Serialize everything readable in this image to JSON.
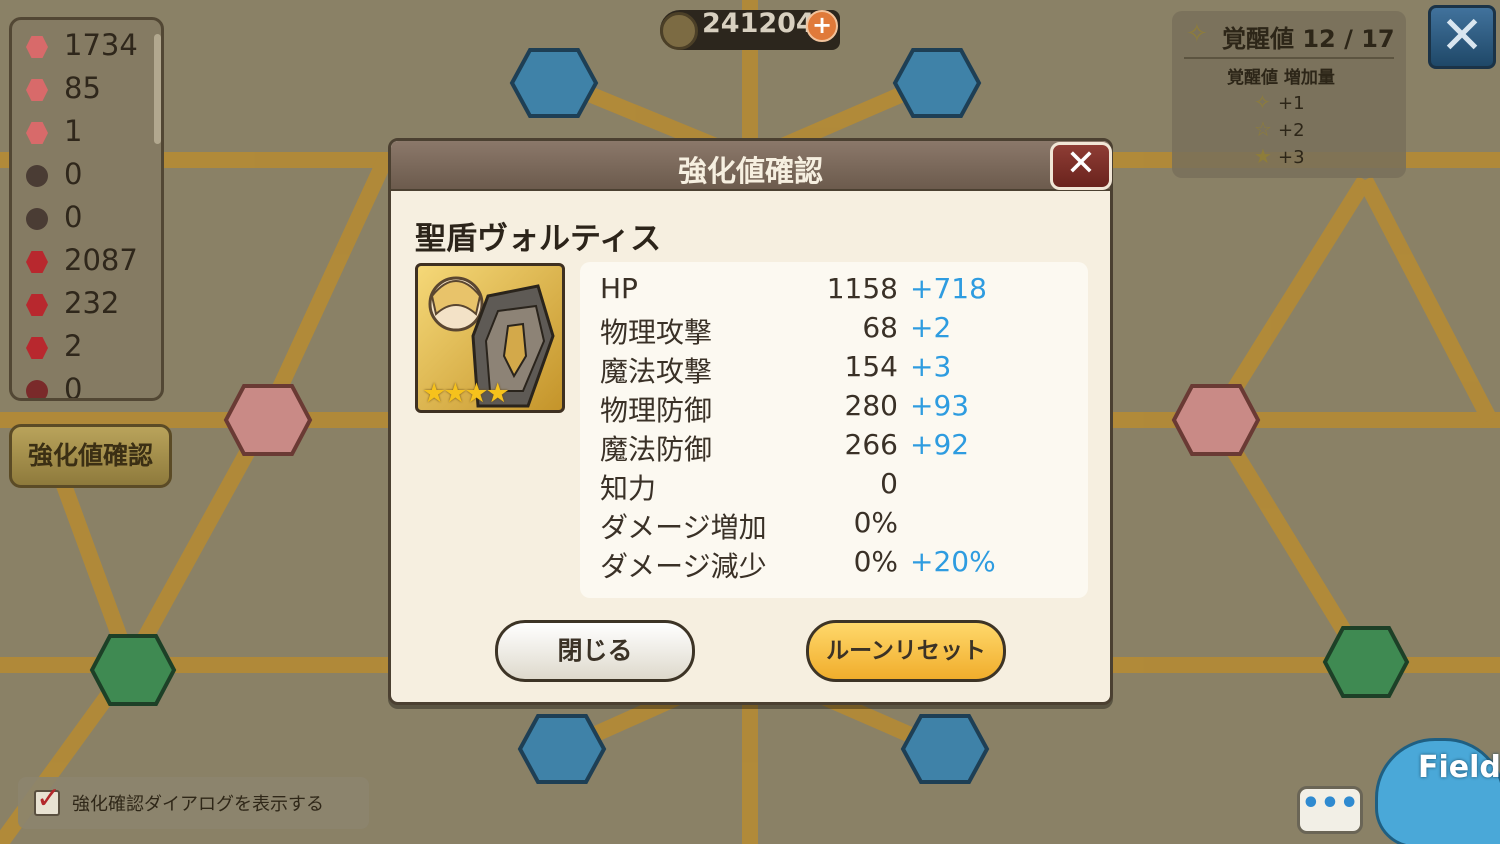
{
  "currency": {
    "value": "241204",
    "add_label": "+"
  },
  "resources": [
    {
      "value": "1734",
      "color": "#d86a6a"
    },
    {
      "value": "85",
      "color": "#d86a6a"
    },
    {
      "value": "1",
      "color": "#d86a6a"
    },
    {
      "value": "0",
      "color": "#4a3c34"
    },
    {
      "value": "0",
      "color": "#4a3c34"
    },
    {
      "value": "2087",
      "color": "#b8282e"
    },
    {
      "value": "232",
      "color": "#b8282e"
    },
    {
      "value": "2",
      "color": "#b8282e"
    },
    {
      "value": "0",
      "color": "#7a2a2a"
    }
  ],
  "side_button": {
    "label": "強化値確認"
  },
  "awakening": {
    "title": "覚醒値 12 / 17",
    "subtitle": "覚醒値 増加量",
    "rows": [
      {
        "label": "+1",
        "icon": "star-outline-icon"
      },
      {
        "label": "+2",
        "icon": "star-icon"
      },
      {
        "label": "+3",
        "icon": "star-icon"
      }
    ]
  },
  "close_label": "✕",
  "checkbox": {
    "label": "強化確認ダイアログを表示する",
    "checked": true
  },
  "chat_label": "•••",
  "field_label": "Field",
  "modal": {
    "title": "強化値確認",
    "close_label": "✕",
    "item_name": "聖盾ヴォルティス",
    "item_stars": "★★★★",
    "stats": [
      {
        "label": "HP",
        "value": "1158",
        "bonus": "+718"
      },
      {
        "label": "物理攻撃",
        "value": "68",
        "bonus": "+2"
      },
      {
        "label": "魔法攻撃",
        "value": "154",
        "bonus": "+3"
      },
      {
        "label": "物理防御",
        "value": "280",
        "bonus": "+93"
      },
      {
        "label": "魔法防御",
        "value": "266",
        "bonus": "+92"
      },
      {
        "label": "知力",
        "value": "0",
        "bonus": ""
      },
      {
        "label": "ダメージ増加",
        "value": "0%",
        "bonus": ""
      },
      {
        "label": "ダメージ減少",
        "value": "0%",
        "bonus": "+20%"
      }
    ],
    "close_button": "閉じる",
    "reset_button": "ルーンリセット"
  },
  "colors": {
    "line": "#d6a23c",
    "shield_node": "#3f82a8",
    "heart_node": "#c98a86",
    "green_node": "#3f8a52",
    "bonus_text": "#2e9ce0"
  }
}
